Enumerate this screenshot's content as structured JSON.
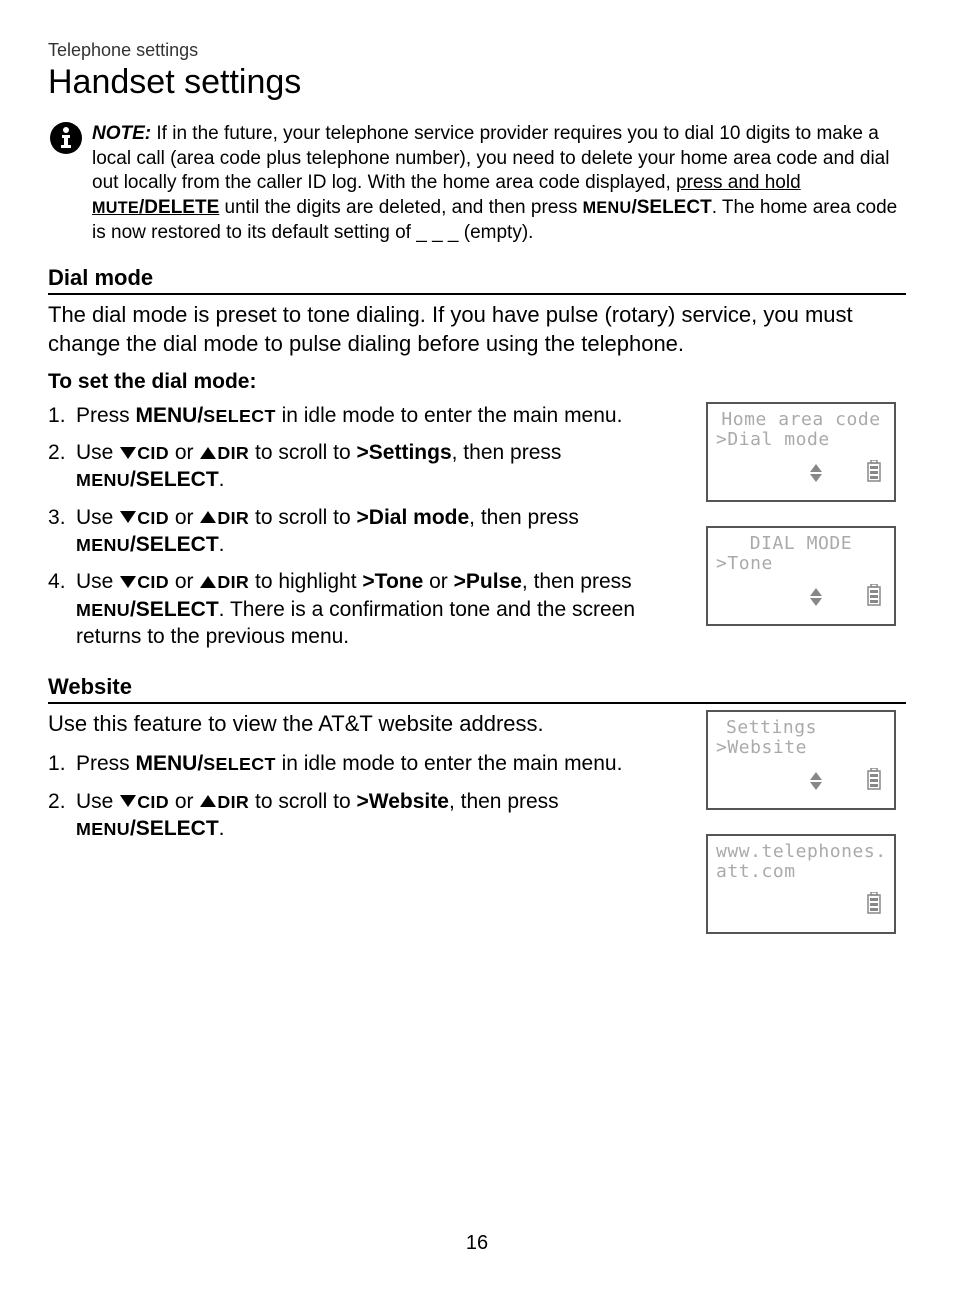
{
  "breadcrumb": "Telephone settings",
  "pageTitle": "Handset settings",
  "note": {
    "label": "NOTE:",
    "body_html": "If in the future, your telephone service provider requires you to dial 10 digits to make a local call (area code plus telephone number), you need to delete your home area code and dial out locally from the caller ID log. With the home area code displayed, <span class='underline'>press and hold <span class='sc'>MUTE</span><b>/DELETE</b></span> until the digits are deleted, and then press <span class='sc'>MENU</span><b>/SELECT</b>. The home area code is now restored to its default setting of _ _ _ (empty)."
  },
  "dialMode": {
    "heading": "Dial mode",
    "intro": "The dial mode is preset to tone dialing. If you have pulse (rotary) service, you must change the dial mode to pulse dialing before using the telephone.",
    "subHeading": "To set the dial mode:",
    "steps": [
      "Press <span class='b'>MENU/<span class='sc'>SELECT</span></span> in idle mode to enter the main menu.",
      "Use <span class='tri tri-down'></span><span class='sc'>CID</span> or <span class='tri tri-up'></span><span class='sc'>DIR</span> to scroll to <span class='b'>>Settings</span>, then press <span class='sc'>MENU</span><span class='b'>/SELECT</span>.",
      "Use <span class='tri tri-down'></span><span class='sc'>CID</span> or <span class='tri tri-up'></span><span class='sc'>DIR</span> to scroll to <span class='b'>>Dial mode</span>, then press <span class='sc'>MENU</span><span class='b'>/SELECT</span>.",
      "Use <span class='tri tri-down'></span><span class='sc'>CID</span> or <span class='tri tri-up'></span><span class='sc'>DIR</span> to highlight <span class='b'>>Tone</span> or <span class='b'>>Pulse</span>, then press <span class='sc'>MENU</span><span class='b'>/SELECT</span>. There is a confirmation tone and the screen returns to the previous menu."
    ]
  },
  "website": {
    "heading": "Website",
    "intro": "Use this feature to view the AT&T website address.",
    "steps": [
      "Press <span class='b'>MENU/<span class='sc'>SELECT</span></span> in idle mode to enter the main menu.",
      "Use <span class='tri tri-down'></span><span class='sc'>CID</span> or <span class='tri tri-up'></span><span class='sc'>DIR</span> to scroll to <span class='b'>>Website</span>, then press <span class='sc'>MENU</span><span class='b'>/SELECT</span>."
    ]
  },
  "lcdScreens": [
    {
      "line1": "Home area code",
      "line2": ">Dial mode",
      "showNav": true
    },
    {
      "line1": "DIAL MODE",
      "line2": ">Tone",
      "showNav": true
    },
    {
      "line1": "Settings",
      "line2": ">Website",
      "showNav": true
    },
    {
      "line1": "www.telephones.",
      "line2": "att.com",
      "showNav": false
    }
  ],
  "pageNumber": "16"
}
